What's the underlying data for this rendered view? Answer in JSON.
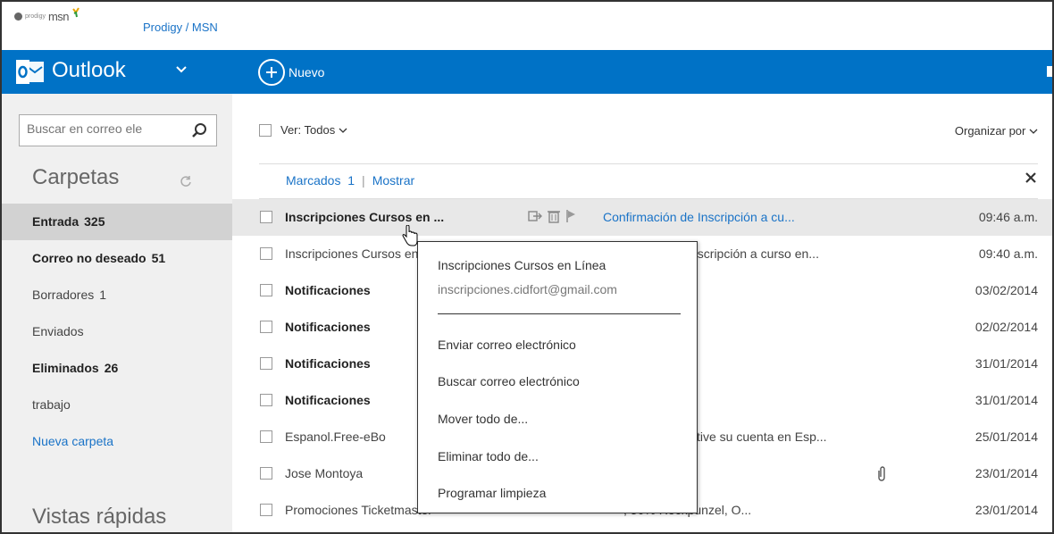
{
  "brand": {
    "logo_small": "prodigy",
    "logo_msn": "msn",
    "title": "Prodigy / MSN"
  },
  "header": {
    "app_name": "Outlook",
    "new_label": "Nuevo",
    "accent": "#0072c6"
  },
  "sidebar": {
    "search_placeholder": "Buscar en correo ele",
    "folders_title": "Carpetas",
    "quick_views_title": "Vistas rápidas",
    "items": [
      {
        "label": "Entrada",
        "count": "325"
      },
      {
        "label": "Correo no deseado",
        "count": "51"
      },
      {
        "label": "Borradores",
        "count": "1"
      },
      {
        "label": "Enviados",
        "count": ""
      },
      {
        "label": "Eliminados",
        "count": "26"
      },
      {
        "label": "trabajo",
        "count": ""
      },
      {
        "label": "Nueva carpeta",
        "count": ""
      }
    ]
  },
  "list": {
    "view_label": "Ver: Todos",
    "organize_label": "Organizar por",
    "flagged_label": "Marcados",
    "flagged_count": "1",
    "show_label": "Mostrar",
    "rows": [
      {
        "sender": "Inscripciones Cursos en ...",
        "subject": "Confirmación de Inscripción a cu...",
        "time": "09:46 a.m."
      },
      {
        "sender": "Inscripciones Cursos en ...",
        "subject": "nscripción a curso en...",
        "time": "09:40 a.m."
      },
      {
        "sender": "Notificaciones",
        "subject": "",
        "time": "03/02/2014"
      },
      {
        "sender": "Notificaciones",
        "subject": "",
        "time": "02/02/2014"
      },
      {
        "sender": "Notificaciones",
        "subject": "",
        "time": "31/01/2014"
      },
      {
        "sender": "Notificaciones",
        "subject": "",
        "time": "31/01/2014"
      },
      {
        "sender": "Espanol.Free-eBo",
        "subject": "tive su cuenta en Esp...",
        "time": "25/01/2014"
      },
      {
        "sender": "Jose Montoya",
        "subject": "",
        "time": "23/01/2014"
      },
      {
        "sender": "Promociones Ticketmaster",
        "subject": ", 50% Rockpunzel, O...",
        "time": "23/01/2014"
      }
    ]
  },
  "popup": {
    "name": "Inscripciones Cursos en Línea",
    "email": "inscripciones.cidfort@gmail.com",
    "items": [
      "Enviar correo electrónico",
      "Buscar correo electrónico",
      "Mover todo de...",
      "Eliminar todo de...",
      "Programar limpieza"
    ]
  }
}
